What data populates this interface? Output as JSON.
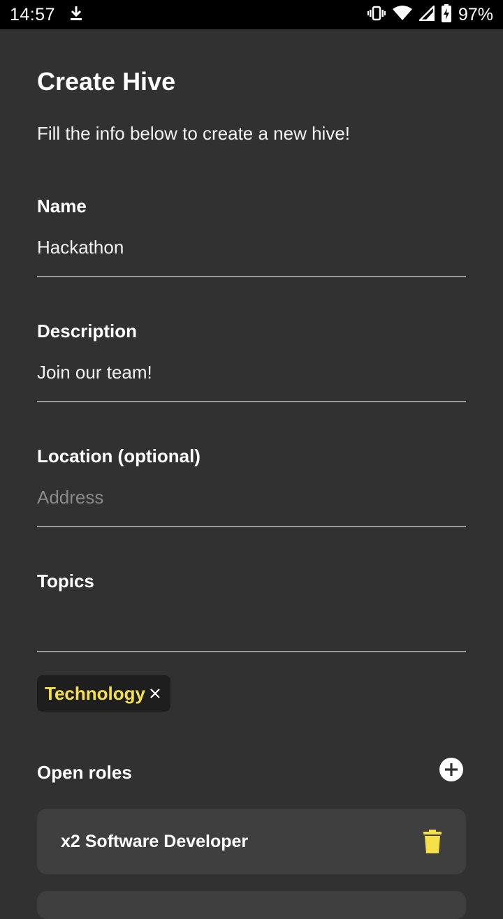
{
  "status_bar": {
    "time": "14:57",
    "battery": "97%"
  },
  "page": {
    "title": "Create Hive",
    "subtitle": "Fill the info below to create a new hive!"
  },
  "form": {
    "name": {
      "label": "Name",
      "value": "Hackathon"
    },
    "description": {
      "label": "Description",
      "value": "Join our team!"
    },
    "location": {
      "label": "Location (optional)",
      "placeholder": "Address",
      "value": ""
    },
    "topics": {
      "label": "Topics",
      "value": "",
      "chips": [
        "Technology"
      ]
    }
  },
  "roles": {
    "heading": "Open roles",
    "items": [
      {
        "label": "x2 Software Developer"
      }
    ]
  },
  "colors": {
    "background": "#313131",
    "accent": "#f5e04a",
    "card": "#3f3f3f",
    "chip": "#1e1e1e"
  }
}
